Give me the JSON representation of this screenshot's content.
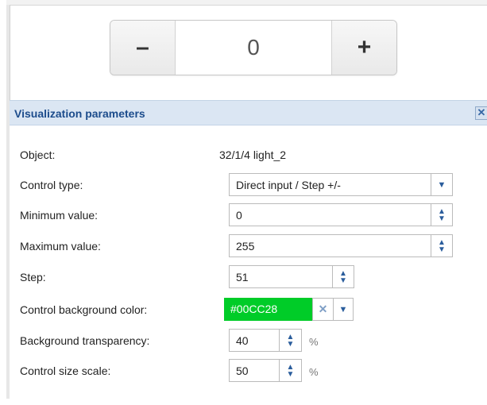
{
  "stepper": {
    "minus_label": "–",
    "value": "0",
    "plus_label": "+"
  },
  "panel": {
    "title": "Visualization parameters",
    "close_label": "✕",
    "rows": {
      "object": {
        "label": "Object:",
        "value": "32/1/4 light_2"
      },
      "control_type": {
        "label": "Control type:",
        "value": "Direct input / Step +/-"
      },
      "min_value": {
        "label": "Minimum value:",
        "value": "0"
      },
      "max_value": {
        "label": "Maximum value:",
        "value": "255"
      },
      "step": {
        "label": "Step:",
        "value": "51"
      },
      "bg_color": {
        "label": "Control background color:",
        "value": "#00CC28",
        "color": "#00CC28"
      },
      "bg_transparency": {
        "label": "Background transparency:",
        "value": "40",
        "unit": "%"
      },
      "size_scale": {
        "label": "Control size scale:",
        "value": "50",
        "unit": "%"
      }
    }
  },
  "colors": {
    "header_bg": "#dbe6f3",
    "title_text": "#1c4c8c",
    "accent": "#2a5d9c"
  },
  "icons": {
    "select_arrow": "chevron-down-icon",
    "spin": "spin-arrows-icon",
    "clear": "clear-x-icon",
    "close": "close-icon"
  }
}
